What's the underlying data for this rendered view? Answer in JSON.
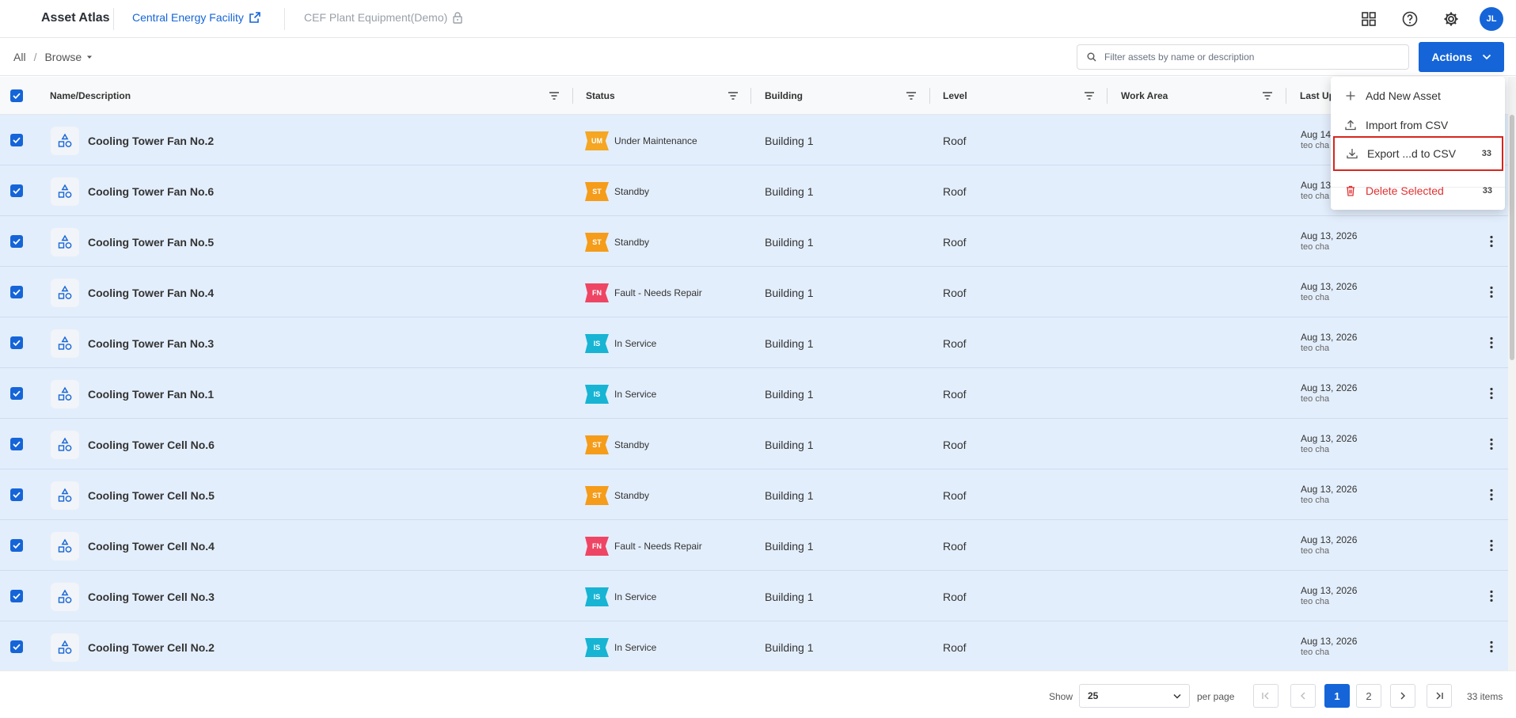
{
  "header": {
    "app_title": "Asset Atlas",
    "site_name": "Central Energy Facility",
    "plant_name": "CEF Plant Equipment(Demo)",
    "avatar_initials": "JL",
    "icons": [
      "grid-apps-icon",
      "help-icon",
      "gear-icon"
    ]
  },
  "breadcrumb": {
    "root": "All",
    "separator": "/",
    "current": "Browse"
  },
  "search": {
    "placeholder": "Filter assets by name or description",
    "value": ""
  },
  "actions": {
    "label": "Actions"
  },
  "menu": {
    "items": [
      {
        "label": "Add New Asset",
        "count": "",
        "icon": "plus-icon"
      },
      {
        "label": "Import from CSV",
        "count": "",
        "icon": "upload-icon"
      },
      {
        "label": "Export ...d to CSV",
        "count": "33",
        "icon": "download-icon"
      },
      {
        "label": "Delete Selected",
        "count": "33",
        "icon": "trash-icon"
      }
    ]
  },
  "table": {
    "columns": [
      "Name/Description",
      "Status",
      "Building",
      "Level",
      "Work Area",
      "Last Up"
    ],
    "rows": [
      {
        "name": "Cooling Tower Fan No.2",
        "status_code": "UM",
        "status": "Under Maintenance",
        "status_color": "#f5a623",
        "building": "Building 1",
        "level": "Roof",
        "updated": "Aug 14",
        "by": "teo cha"
      },
      {
        "name": "Cooling Tower Fan No.6",
        "status_code": "ST",
        "status": "Standby",
        "status_color": "#f59c1a",
        "building": "Building 1",
        "level": "Roof",
        "updated": "Aug 13",
        "by": "teo cha"
      },
      {
        "name": "Cooling Tower Fan No.5",
        "status_code": "ST",
        "status": "Standby",
        "status_color": "#f59c1a",
        "building": "Building 1",
        "level": "Roof",
        "updated": "Aug 13, 2026",
        "by": "teo cha"
      },
      {
        "name": "Cooling Tower Fan No.4",
        "status_code": "FN",
        "status": "Fault - Needs Repair",
        "status_color": "#ef4564",
        "building": "Building 1",
        "level": "Roof",
        "updated": "Aug 13, 2026",
        "by": "teo cha"
      },
      {
        "name": "Cooling Tower Fan No.3",
        "status_code": "IS",
        "status": "In Service",
        "status_color": "#17b4d4",
        "building": "Building 1",
        "level": "Roof",
        "updated": "Aug 13, 2026",
        "by": "teo cha"
      },
      {
        "name": "Cooling Tower Fan No.1",
        "status_code": "IS",
        "status": "In Service",
        "status_color": "#17b4d4",
        "building": "Building 1",
        "level": "Roof",
        "updated": "Aug 13, 2026",
        "by": "teo cha"
      },
      {
        "name": "Cooling Tower Cell No.6",
        "status_code": "ST",
        "status": "Standby",
        "status_color": "#f59c1a",
        "building": "Building 1",
        "level": "Roof",
        "updated": "Aug 13, 2026",
        "by": "teo cha"
      },
      {
        "name": "Cooling Tower Cell No.5",
        "status_code": "ST",
        "status": "Standby",
        "status_color": "#f59c1a",
        "building": "Building 1",
        "level": "Roof",
        "updated": "Aug 13, 2026",
        "by": "teo cha"
      },
      {
        "name": "Cooling Tower Cell No.4",
        "status_code": "FN",
        "status": "Fault - Needs Repair",
        "status_color": "#ef4564",
        "building": "Building 1",
        "level": "Roof",
        "updated": "Aug 13, 2026",
        "by": "teo cha"
      },
      {
        "name": "Cooling Tower Cell No.3",
        "status_code": "IS",
        "status": "In Service",
        "status_color": "#17b4d4",
        "building": "Building 1",
        "level": "Roof",
        "updated": "Aug 13, 2026",
        "by": "teo cha"
      },
      {
        "name": "Cooling Tower Cell No.2",
        "status_code": "IS",
        "status": "In Service",
        "status_color": "#17b4d4",
        "building": "Building 1",
        "level": "Roof",
        "updated": "Aug 13, 2026",
        "by": "teo cha"
      }
    ]
  },
  "pagination": {
    "show_label": "Show",
    "per_page_value": "25",
    "per_page_label": "per page",
    "pages": [
      "1",
      "2"
    ],
    "current_page": "1",
    "total": "33 items"
  },
  "colors": {
    "accent": "#1565d8",
    "row_selected": "#e3eefc",
    "danger": "#e03131",
    "highlight_border": "#d7261e"
  }
}
